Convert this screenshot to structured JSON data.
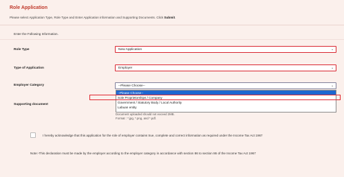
{
  "heading": "Role Application",
  "instructions": {
    "text": "Please select Application Type, Role Type and Enter Application information and Supporting Documents. Click ",
    "emphasis": "Submit",
    "suffix": "."
  },
  "form": {
    "section_title": "Enter the Following Information.",
    "role_type": {
      "label": "Role Type",
      "value": "New Application"
    },
    "application_type": {
      "label": "Type of Application",
      "value": "Employer"
    },
    "employer_category": {
      "label": "Employer Category",
      "value": "--Please Choose--",
      "options": [
        "--Please Choose--",
        "Sole Proprietorships / Company",
        "Government / Statutory Body / Local Authority",
        "Labuan entity"
      ]
    },
    "supporting_document": {
      "label": "Supporting document",
      "hint_size": "Document uploaded should not exceed 2MB.",
      "hint_format": "Format : *.jpg, *.png, and *.pdf."
    },
    "acknowledgement": "I hereby acknowledge that this application for the role of employer contains true, complete and correct information as required under the Income Tax Act 1967",
    "note": "Note:-This declaration must be made by the employer according to the employer category in accordance with section 86 to section 86 of the Income Tax Act 1967"
  },
  "icons": {
    "select_arrow": "chevron-down-icon"
  },
  "colors": {
    "accent": "#c0392b",
    "error_border": "#d9252f",
    "selected_option": "#1e66d0",
    "background": "#fbf0ec"
  }
}
